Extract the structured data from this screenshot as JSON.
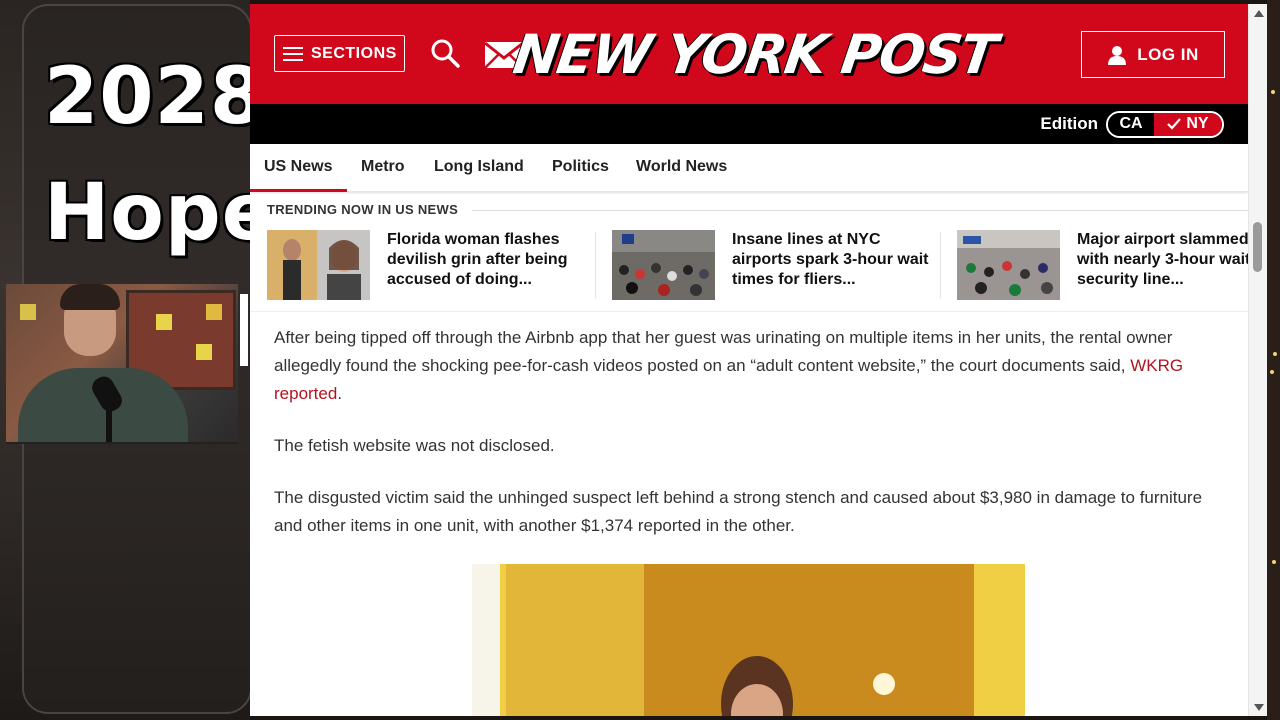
{
  "overlay": {
    "title_line1": "2028",
    "title_line2": "Hope"
  },
  "site": {
    "logo": "NEW YORK POST",
    "sections_label": "SECTIONS",
    "login_label": "LOG IN",
    "edition_label": "Edition",
    "edition_options": [
      "CA",
      "NY"
    ],
    "edition_selected": "NY",
    "brand_color": "#d1071c"
  },
  "nav": {
    "items": [
      "US News",
      "Metro",
      "Long Island",
      "Politics",
      "World News"
    ],
    "active": "US News"
  },
  "trending": {
    "heading": "TRENDING NOW IN US NEWS",
    "items": [
      {
        "text": "Florida woman flashes devilish grin after being accused of doing..."
      },
      {
        "text": "Insane lines at NYC airports spark 3-hour wait times for fliers..."
      },
      {
        "text": "Major airport slammed with nearly 3-hour wait as security line..."
      }
    ]
  },
  "article": {
    "p1_before_link": "After being tipped off through the Airbnb app that her guest was urinating on multiple items in her units, the rental owner allegedly found the shocking pee-for-cash videos posted on an “adult content website,” the court documents said, ",
    "p1_link": "WKRG reported",
    "p1_after_link": ".",
    "p2": "The fetish website was not disclosed.",
    "p3": "The disgusted victim said the unhinged suspect left behind a strong stench and caused about $3,980 in damage to furniture and other items in one unit, with another $1,374 reported in the other."
  }
}
